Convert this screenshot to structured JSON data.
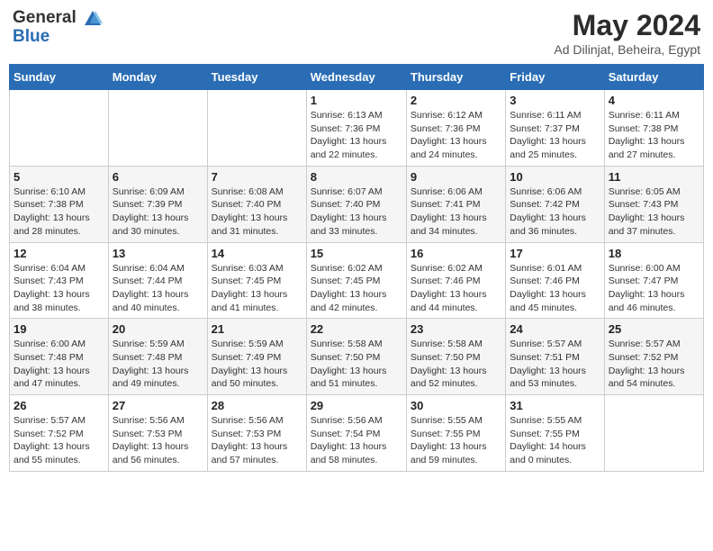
{
  "logo": {
    "line1": "General",
    "line2": "Blue"
  },
  "title": "May 2024",
  "location": "Ad Dilinjat, Beheira, Egypt",
  "weekdays": [
    "Sunday",
    "Monday",
    "Tuesday",
    "Wednesday",
    "Thursday",
    "Friday",
    "Saturday"
  ],
  "weeks": [
    [
      {
        "day": "",
        "sunrise": "",
        "sunset": "",
        "daylight": ""
      },
      {
        "day": "",
        "sunrise": "",
        "sunset": "",
        "daylight": ""
      },
      {
        "day": "",
        "sunrise": "",
        "sunset": "",
        "daylight": ""
      },
      {
        "day": "1",
        "sunrise": "Sunrise: 6:13 AM",
        "sunset": "Sunset: 7:36 PM",
        "daylight": "Daylight: 13 hours and 22 minutes."
      },
      {
        "day": "2",
        "sunrise": "Sunrise: 6:12 AM",
        "sunset": "Sunset: 7:36 PM",
        "daylight": "Daylight: 13 hours and 24 minutes."
      },
      {
        "day": "3",
        "sunrise": "Sunrise: 6:11 AM",
        "sunset": "Sunset: 7:37 PM",
        "daylight": "Daylight: 13 hours and 25 minutes."
      },
      {
        "day": "4",
        "sunrise": "Sunrise: 6:11 AM",
        "sunset": "Sunset: 7:38 PM",
        "daylight": "Daylight: 13 hours and 27 minutes."
      }
    ],
    [
      {
        "day": "5",
        "sunrise": "Sunrise: 6:10 AM",
        "sunset": "Sunset: 7:38 PM",
        "daylight": "Daylight: 13 hours and 28 minutes."
      },
      {
        "day": "6",
        "sunrise": "Sunrise: 6:09 AM",
        "sunset": "Sunset: 7:39 PM",
        "daylight": "Daylight: 13 hours and 30 minutes."
      },
      {
        "day": "7",
        "sunrise": "Sunrise: 6:08 AM",
        "sunset": "Sunset: 7:40 PM",
        "daylight": "Daylight: 13 hours and 31 minutes."
      },
      {
        "day": "8",
        "sunrise": "Sunrise: 6:07 AM",
        "sunset": "Sunset: 7:40 PM",
        "daylight": "Daylight: 13 hours and 33 minutes."
      },
      {
        "day": "9",
        "sunrise": "Sunrise: 6:06 AM",
        "sunset": "Sunset: 7:41 PM",
        "daylight": "Daylight: 13 hours and 34 minutes."
      },
      {
        "day": "10",
        "sunrise": "Sunrise: 6:06 AM",
        "sunset": "Sunset: 7:42 PM",
        "daylight": "Daylight: 13 hours and 36 minutes."
      },
      {
        "day": "11",
        "sunrise": "Sunrise: 6:05 AM",
        "sunset": "Sunset: 7:43 PM",
        "daylight": "Daylight: 13 hours and 37 minutes."
      }
    ],
    [
      {
        "day": "12",
        "sunrise": "Sunrise: 6:04 AM",
        "sunset": "Sunset: 7:43 PM",
        "daylight": "Daylight: 13 hours and 38 minutes."
      },
      {
        "day": "13",
        "sunrise": "Sunrise: 6:04 AM",
        "sunset": "Sunset: 7:44 PM",
        "daylight": "Daylight: 13 hours and 40 minutes."
      },
      {
        "day": "14",
        "sunrise": "Sunrise: 6:03 AM",
        "sunset": "Sunset: 7:45 PM",
        "daylight": "Daylight: 13 hours and 41 minutes."
      },
      {
        "day": "15",
        "sunrise": "Sunrise: 6:02 AM",
        "sunset": "Sunset: 7:45 PM",
        "daylight": "Daylight: 13 hours and 42 minutes."
      },
      {
        "day": "16",
        "sunrise": "Sunrise: 6:02 AM",
        "sunset": "Sunset: 7:46 PM",
        "daylight": "Daylight: 13 hours and 44 minutes."
      },
      {
        "day": "17",
        "sunrise": "Sunrise: 6:01 AM",
        "sunset": "Sunset: 7:46 PM",
        "daylight": "Daylight: 13 hours and 45 minutes."
      },
      {
        "day": "18",
        "sunrise": "Sunrise: 6:00 AM",
        "sunset": "Sunset: 7:47 PM",
        "daylight": "Daylight: 13 hours and 46 minutes."
      }
    ],
    [
      {
        "day": "19",
        "sunrise": "Sunrise: 6:00 AM",
        "sunset": "Sunset: 7:48 PM",
        "daylight": "Daylight: 13 hours and 47 minutes."
      },
      {
        "day": "20",
        "sunrise": "Sunrise: 5:59 AM",
        "sunset": "Sunset: 7:48 PM",
        "daylight": "Daylight: 13 hours and 49 minutes."
      },
      {
        "day": "21",
        "sunrise": "Sunrise: 5:59 AM",
        "sunset": "Sunset: 7:49 PM",
        "daylight": "Daylight: 13 hours and 50 minutes."
      },
      {
        "day": "22",
        "sunrise": "Sunrise: 5:58 AM",
        "sunset": "Sunset: 7:50 PM",
        "daylight": "Daylight: 13 hours and 51 minutes."
      },
      {
        "day": "23",
        "sunrise": "Sunrise: 5:58 AM",
        "sunset": "Sunset: 7:50 PM",
        "daylight": "Daylight: 13 hours and 52 minutes."
      },
      {
        "day": "24",
        "sunrise": "Sunrise: 5:57 AM",
        "sunset": "Sunset: 7:51 PM",
        "daylight": "Daylight: 13 hours and 53 minutes."
      },
      {
        "day": "25",
        "sunrise": "Sunrise: 5:57 AM",
        "sunset": "Sunset: 7:52 PM",
        "daylight": "Daylight: 13 hours and 54 minutes."
      }
    ],
    [
      {
        "day": "26",
        "sunrise": "Sunrise: 5:57 AM",
        "sunset": "Sunset: 7:52 PM",
        "daylight": "Daylight: 13 hours and 55 minutes."
      },
      {
        "day": "27",
        "sunrise": "Sunrise: 5:56 AM",
        "sunset": "Sunset: 7:53 PM",
        "daylight": "Daylight: 13 hours and 56 minutes."
      },
      {
        "day": "28",
        "sunrise": "Sunrise: 5:56 AM",
        "sunset": "Sunset: 7:53 PM",
        "daylight": "Daylight: 13 hours and 57 minutes."
      },
      {
        "day": "29",
        "sunrise": "Sunrise: 5:56 AM",
        "sunset": "Sunset: 7:54 PM",
        "daylight": "Daylight: 13 hours and 58 minutes."
      },
      {
        "day": "30",
        "sunrise": "Sunrise: 5:55 AM",
        "sunset": "Sunset: 7:55 PM",
        "daylight": "Daylight: 13 hours and 59 minutes."
      },
      {
        "day": "31",
        "sunrise": "Sunrise: 5:55 AM",
        "sunset": "Sunset: 7:55 PM",
        "daylight": "Daylight: 14 hours and 0 minutes."
      },
      {
        "day": "",
        "sunrise": "",
        "sunset": "",
        "daylight": ""
      }
    ]
  ]
}
